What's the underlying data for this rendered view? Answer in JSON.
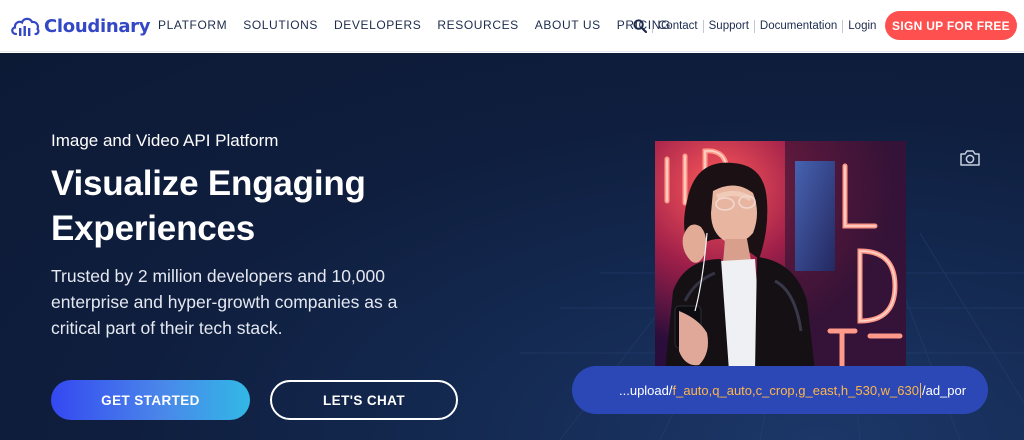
{
  "brand": {
    "name": "Cloudinary",
    "logo_icon": "cloud-bars-icon",
    "color": "#3448c5"
  },
  "nav": {
    "items": [
      {
        "label": "PLATFORM"
      },
      {
        "label": "SOLUTIONS"
      },
      {
        "label": "DEVELOPERS"
      },
      {
        "label": "RESOURCES"
      },
      {
        "label": "ABOUT US"
      },
      {
        "label": "PRICING"
      }
    ],
    "search_icon": "search-icon",
    "utility_links": [
      {
        "label": "Contact"
      },
      {
        "label": "Support"
      },
      {
        "label": "Documentation"
      },
      {
        "label": "Login"
      }
    ],
    "cta_label": "SIGN UP FOR FREE",
    "cta_color": "#ff5050"
  },
  "hero": {
    "eyebrow": "Image and Video API Platform",
    "headline_line1": "Visualize Engaging",
    "headline_line2": "Experiences",
    "subtext": "Trusted by 2 million developers and 10,000 enterprise and hyper-growth companies as a critical part of their tech stack.",
    "primary_button": "GET STARTED",
    "secondary_button": "LET'S CHAT",
    "camera_icon": "camera-icon",
    "url": {
      "prefix": "...upload/",
      "transform": "f_auto,q_auto,c_crop,g_east,h_530,w_630",
      "suffix": "/ad_por"
    },
    "colors": {
      "background": "#0f1e3e",
      "url_bar": "#2c48b6",
      "url_highlight": "#ffb648"
    }
  }
}
